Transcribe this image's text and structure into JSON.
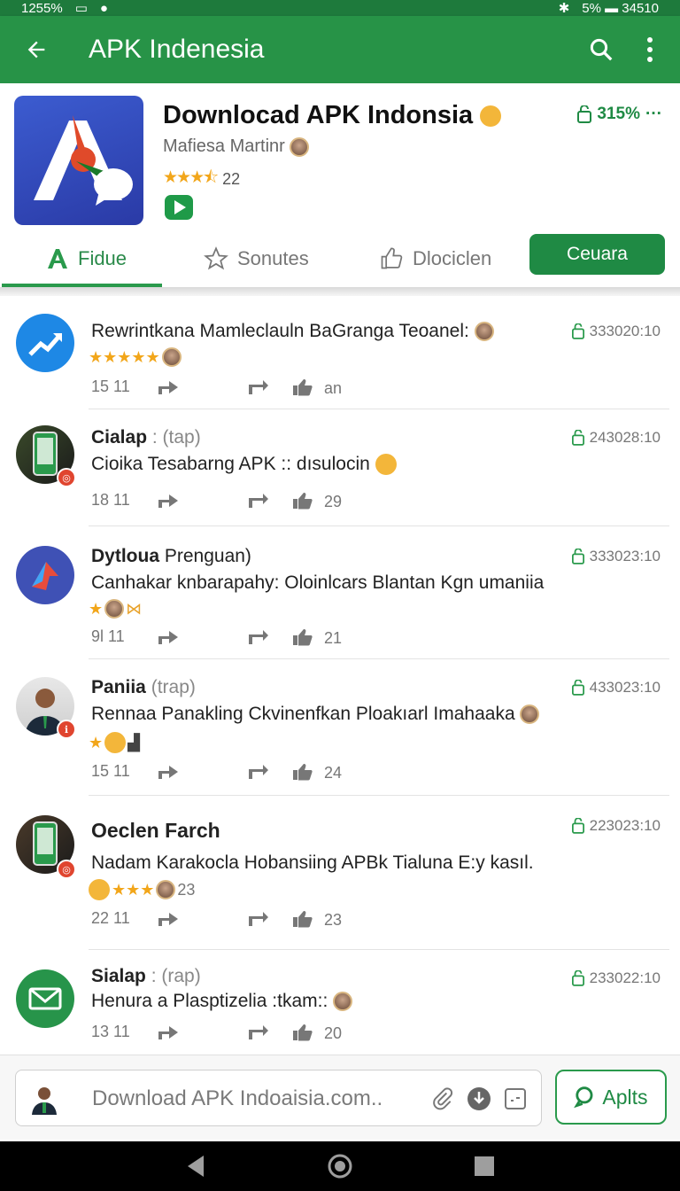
{
  "status": {
    "left_text": "1255%",
    "right_text": "5% ▬ 34510"
  },
  "appbar": {
    "title": "APK Indenesia"
  },
  "app": {
    "name": "Downlocad APK Indonsia",
    "developer": "Mafiesa Martinr",
    "stars": "★★★⯪",
    "rating_count": "22",
    "size": "315%"
  },
  "tabs": [
    {
      "label": "Fidue"
    },
    {
      "label": "Sonutes"
    },
    {
      "label": "Dlociclen"
    }
  ],
  "cta_label": "Ceuara",
  "items": [
    {
      "title": "Rewrintkana Mamleclauln BaGranga Teoanel:",
      "title_sub": "",
      "body": "",
      "emojis": "★★★★★",
      "time": "15 11",
      "count": "an",
      "stamp": "333020:10"
    },
    {
      "title": "Cialap",
      "title_sub": " : (tap)",
      "body": "Cioika Tesabarng APK :: dısulocin",
      "emojis": "",
      "time": "18 11",
      "count": "29",
      "stamp": "243028:10"
    },
    {
      "title": "Dytloua",
      "title_sub": " Prenguan)",
      "body": "Canhakar knbarapahy: Oloinlcars Blantan Kgn umaniia",
      "emojis": "★",
      "time": "9l 11",
      "count": "21",
      "stamp": "333023:10"
    },
    {
      "title": "Paniia",
      "title_sub": " (trap)",
      "body": "Rennaa Panakling Ckvinenfkan Ploakıarl Imahaaka",
      "emojis": "★",
      "time": "15 11",
      "count": "24",
      "stamp": "433023:10"
    },
    {
      "title": "Oeclen Farch",
      "title_sub": "",
      "body": "Nadam Karakocla Hobansiing APBk Tialuna E:y kasıl.",
      "emojis": "★★★",
      "emoji_count": "23",
      "time": "22 11",
      "count": "23",
      "stamp": "223023:10"
    },
    {
      "title": "Sialap",
      "title_sub": " : (rap)",
      "body": "Henura a Plasptizelia :tkam::",
      "emojis": "",
      "time": "13 11",
      "count": "20",
      "stamp": "233022:10"
    }
  ],
  "input": {
    "placeholder": "Download APK Indoaisia.com.."
  },
  "apply_label": "Aplts"
}
